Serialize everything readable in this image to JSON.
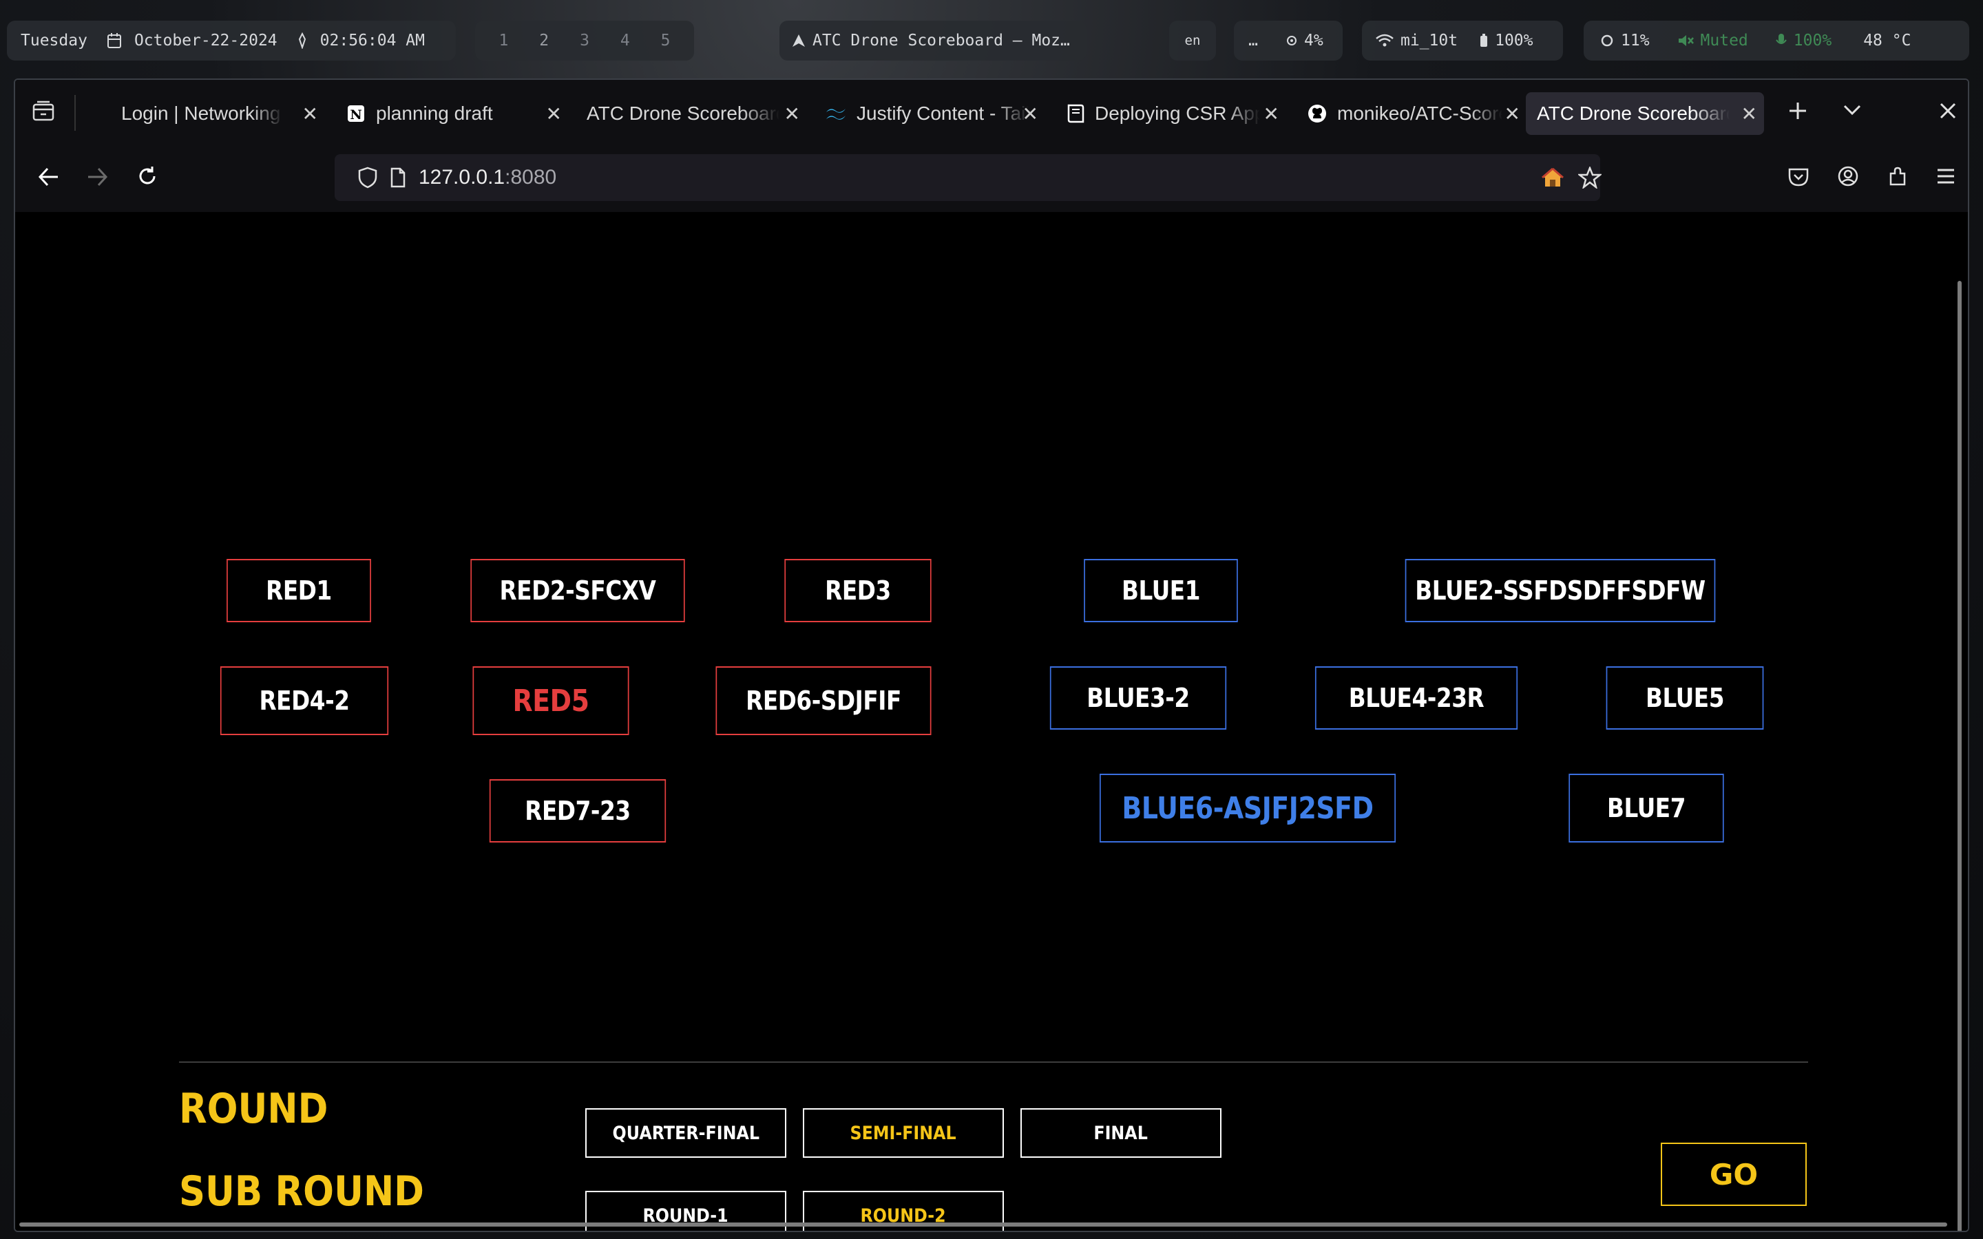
{
  "system_bar": {
    "day": "Tuesday",
    "date": "October-22-2024",
    "time": "02:56:04 AM",
    "workspaces": [
      "1",
      "2",
      "3",
      "4",
      "5"
    ],
    "window_title": "ATC Drone Scoreboard — Moz…",
    "language": "en",
    "overflow": "…",
    "cpu": "4%",
    "wifi": "mi_10t",
    "battery": "100%",
    "brightness": "11%",
    "volume": "Muted",
    "mic": "100%",
    "temperature": "48 °C"
  },
  "browser": {
    "tabs": [
      {
        "label": "Login | Networking"
      },
      {
        "label": "planning draft"
      },
      {
        "label": "ATC Drone Scoreboard"
      },
      {
        "label": "Justify Content - Tailwind"
      },
      {
        "label": "Deploying CSR Apps"
      },
      {
        "label": "monikeo/ATC-Scoreboard"
      },
      {
        "label": "ATC Drone Scoreboard"
      }
    ],
    "url_host": "127.0.0.1",
    "url_port": ":8080"
  },
  "scoreboard": {
    "red_teams": [
      "RED1",
      "RED2-SFCXV",
      "RED3",
      "RED4-2",
      "RED5",
      "RED6-SDJFIF",
      "RED7-23"
    ],
    "blue_teams": [
      "BLUE1",
      "BLUE2-SSFDSDFFSDFW",
      "BLUE3-2",
      "BLUE4-23R",
      "BLUE5",
      "BLUE6-ASJFJ2SFD",
      "BLUE7"
    ],
    "selected_red": "RED5",
    "selected_blue": "BLUE6-ASJFJ2SFD",
    "round_label": "ROUND",
    "sub_round_label": "SUB ROUND",
    "round_options": [
      "QUARTER-FINAL",
      "SEMI-FINAL",
      "FINAL"
    ],
    "selected_round": "SEMI-FINAL",
    "sub_round_options": [
      "ROUND-1",
      "ROUND-2"
    ],
    "selected_sub_round": "ROUND-2",
    "go_label": "GO"
  },
  "colors": {
    "red": "#e53e3e",
    "blue": "#3b6fe0",
    "accent_yellow": "#f5c518",
    "background": "#000000"
  }
}
